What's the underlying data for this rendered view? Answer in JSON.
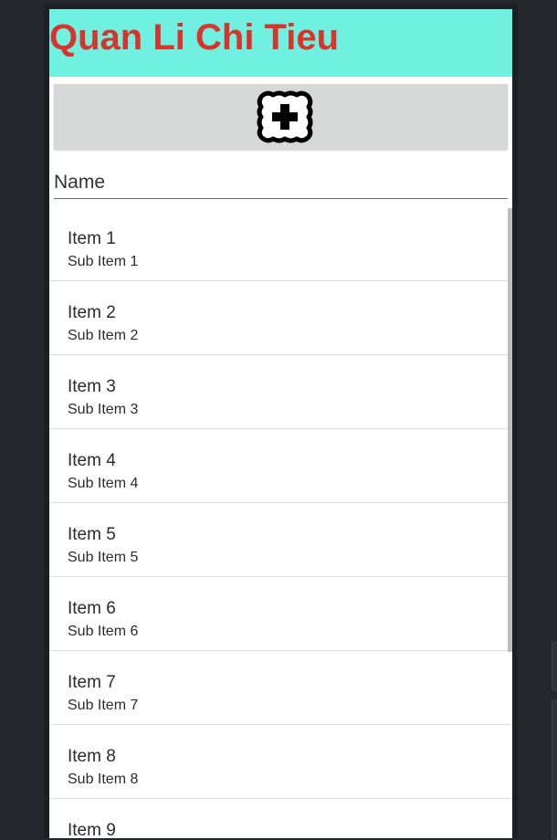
{
  "app": {
    "title": "Quan Li Chi Tieu"
  },
  "colors": {
    "title_bar_background": "#6ff0e0",
    "title_text": "#d8342c",
    "add_button_background": "#d6d8d8"
  },
  "toolbar": {
    "add_button_icon": "add-picture-frame-icon"
  },
  "form": {
    "name_placeholder": "Name",
    "name_value": ""
  },
  "list": {
    "items": [
      {
        "title": "Item 1",
        "subtitle": "Sub Item 1"
      },
      {
        "title": "Item 2",
        "subtitle": "Sub Item 2"
      },
      {
        "title": "Item 3",
        "subtitle": "Sub Item 3"
      },
      {
        "title": "Item 4",
        "subtitle": "Sub Item 4"
      },
      {
        "title": "Item 5",
        "subtitle": "Sub Item 5"
      },
      {
        "title": "Item 6",
        "subtitle": "Sub Item 6"
      },
      {
        "title": "Item 7",
        "subtitle": "Sub Item 7"
      },
      {
        "title": "Item 8",
        "subtitle": "Sub Item 8"
      },
      {
        "title": "Item 9"
      }
    ]
  }
}
